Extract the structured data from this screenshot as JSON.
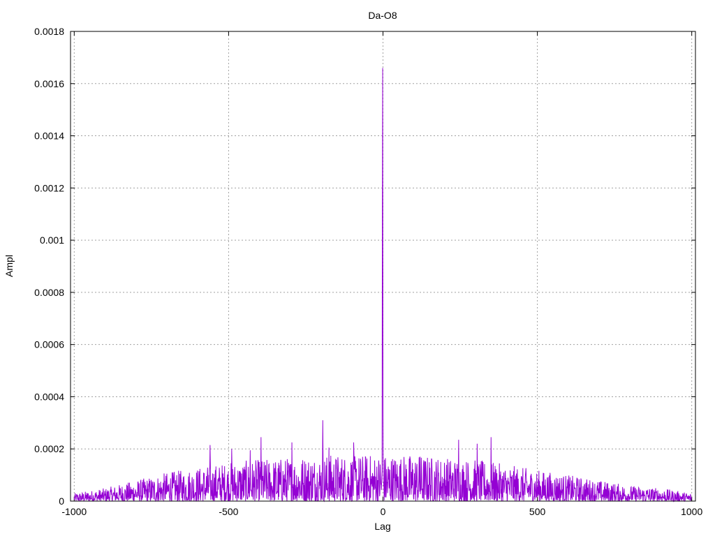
{
  "chart_data": {
    "type": "line",
    "title": "Da-O8",
    "xlabel": "Lag",
    "ylabel": "Ampl",
    "xlim": [
      -1012,
      1012
    ],
    "ylim": [
      0,
      0.0018
    ],
    "grid": true,
    "x_ticks": [
      -1000,
      -500,
      0,
      500,
      1000
    ],
    "x_tick_labels": [
      "-1000",
      "-500",
      "0",
      "500",
      "1000"
    ],
    "y_ticks": [
      0,
      0.0002,
      0.0004,
      0.0006,
      0.0008,
      0.001,
      0.0012,
      0.0014,
      0.0016,
      0.0018
    ],
    "y_tick_labels": [
      "0",
      "0.0002",
      "0.0004",
      "0.0006",
      "0.0008",
      "0.001",
      "0.0012",
      "0.0014",
      "0.0016",
      "0.0018"
    ],
    "series": [
      {
        "color": "#9400d3",
        "peaks": [
          {
            "x": -1,
            "y": 0.00166
          },
          {
            "x": -2,
            "y": 0.00114
          },
          {
            "x": 0,
            "y": 0.00035
          },
          {
            "x": -195,
            "y": 0.00031
          },
          {
            "x": -560,
            "y": 0.000215
          },
          {
            "x": -395,
            "y": 0.000245
          },
          {
            "x": -295,
            "y": 0.000225
          },
          {
            "x": -95,
            "y": 0.000225
          },
          {
            "x": 245,
            "y": 0.000235
          },
          {
            "x": 350,
            "y": 0.000245
          },
          {
            "x": 305,
            "y": 0.00022
          },
          {
            "x": -490,
            "y": 0.0002
          },
          {
            "x": -430,
            "y": 0.000195
          },
          {
            "x": -175,
            "y": 0.000205
          },
          {
            "x": 120,
            "y": 0.00017
          }
        ],
        "envelope": [
          {
            "x": -1000,
            "y": 3e-05
          },
          {
            "x": -900,
            "y": 5e-05
          },
          {
            "x": -800,
            "y": 8e-05
          },
          {
            "x": -700,
            "y": 0.00011
          },
          {
            "x": -600,
            "y": 0.00013
          },
          {
            "x": -500,
            "y": 0.00015
          },
          {
            "x": -400,
            "y": 0.00016
          },
          {
            "x": -300,
            "y": 0.00017
          },
          {
            "x": -200,
            "y": 0.00018
          },
          {
            "x": -100,
            "y": 0.00018
          },
          {
            "x": 0,
            "y": 0.00018
          },
          {
            "x": 100,
            "y": 0.00018
          },
          {
            "x": 200,
            "y": 0.00017
          },
          {
            "x": 300,
            "y": 0.00016
          },
          {
            "x": 400,
            "y": 0.00014
          },
          {
            "x": 500,
            "y": 0.00012
          },
          {
            "x": 600,
            "y": 0.0001
          },
          {
            "x": 700,
            "y": 8e-05
          },
          {
            "x": 800,
            "y": 6e-05
          },
          {
            "x": 900,
            "y": 5e-05
          },
          {
            "x": 1000,
            "y": 3e-05
          }
        ]
      }
    ]
  }
}
